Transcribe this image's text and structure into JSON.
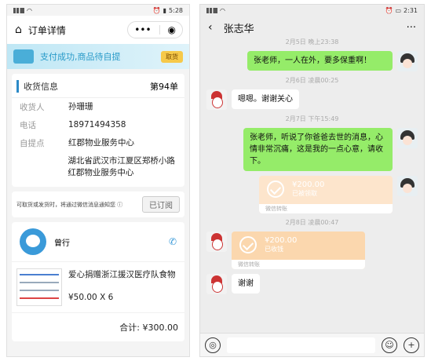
{
  "left": {
    "status": {
      "signal": "ull",
      "time": "5:28"
    },
    "header": {
      "title": "订单详情"
    },
    "banner": {
      "text": "支付成功,商品待自提",
      "pill": "取货"
    },
    "info": {
      "heading": "收货信息",
      "order_no": "第94单",
      "rows": [
        {
          "key": "收货人",
          "value": "孙珊珊"
        },
        {
          "key": "电话",
          "value": "18971494358"
        },
        {
          "key": "自提点",
          "value": "红郡物业服务中心"
        }
      ],
      "address": "湖北省武汉市江夏区郑桥小路红郡物业服务中心"
    },
    "subscribe": {
      "text": "可取货或发货时，将通过微信消息通知您 ⓘ",
      "button": "已订阅"
    },
    "shop": {
      "name": "曾行"
    },
    "product": {
      "name": "爱心捐赠浙江援汉医疗队食物",
      "price": "¥50.00 X 6"
    },
    "total": "合计: ¥300.00"
  },
  "right": {
    "status": {
      "time": "2:31"
    },
    "header": {
      "name": "张志华",
      "more": "···"
    },
    "messages": {
      "ts1": "2月5日 晚上23:38",
      "m1": "张老师，一人在外，要多保重啊！",
      "ts2": "2月6日 凌晨00:25",
      "m2": "嗯嗯。谢谢关心",
      "ts3": "2月7日 下午15:49",
      "m3": "张老师，听说了你爸爸去世的消息，心情非常沉痛，这是我的一点心意，请收下。",
      "t1_amount": "¥200.00",
      "t1_status": "已被领取",
      "t1_foot": "微信转账",
      "ts4": "2月8日 凌晨00:47",
      "t2_amount": "¥200.00",
      "t2_status": "已收钱",
      "t2_foot": "微信转账",
      "m4": "谢谢"
    }
  },
  "icons": [
    "home-icon",
    "more-icon",
    "target-icon",
    "phone-icon",
    "back-icon",
    "voice-icon",
    "emoji-icon",
    "plus-icon"
  ]
}
